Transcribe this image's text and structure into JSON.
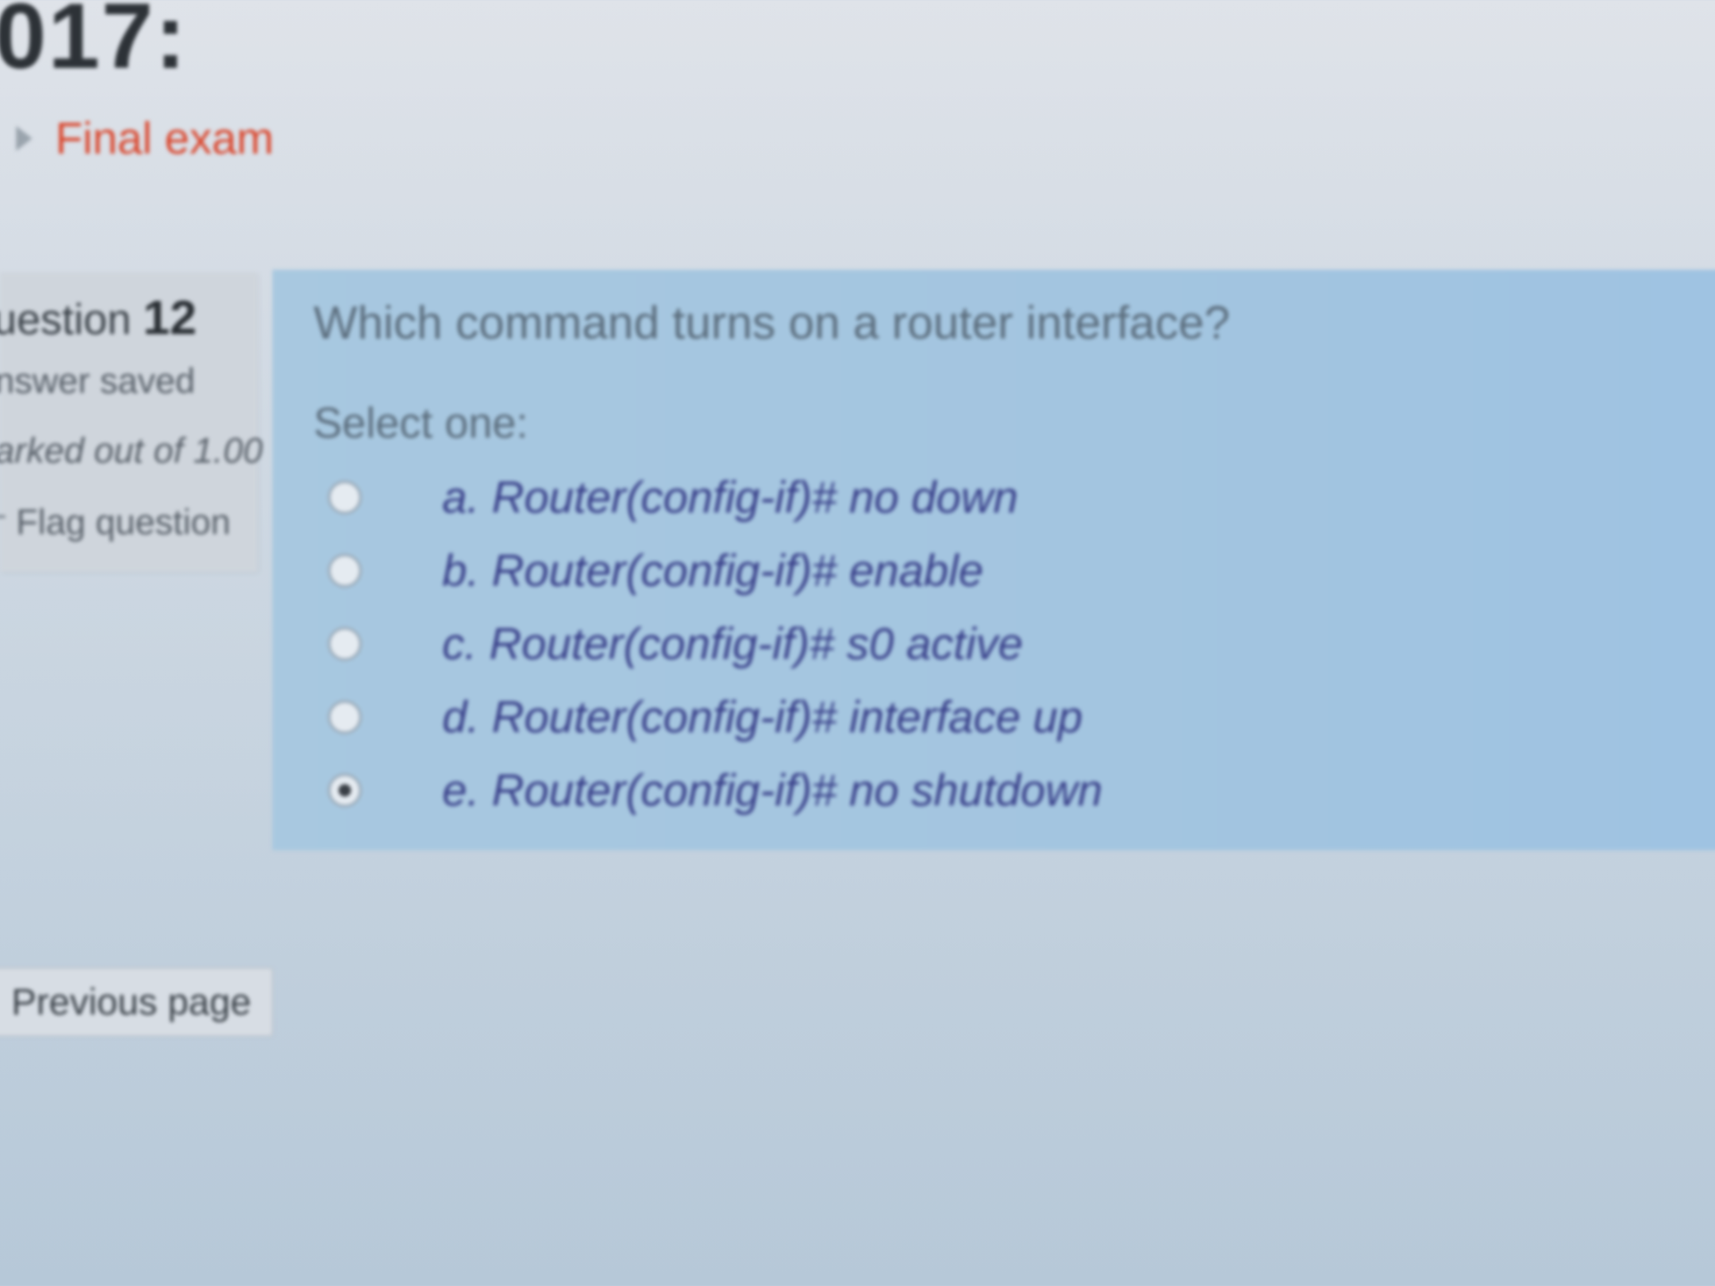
{
  "header": {
    "title": "017:"
  },
  "breadcrumb": {
    "link": "Final exam"
  },
  "question_info": {
    "number_label": "uestion",
    "number": "12",
    "status": "nswer saved",
    "marks": "arked out of 1.00",
    "flag_label": "Flag question"
  },
  "question": {
    "text": "Which command turns on a router interface?",
    "prompt": "Select one:",
    "options": [
      {
        "label": "a. Router(config-if)# no down",
        "selected": false
      },
      {
        "label": "b. Router(config-if)# enable",
        "selected": false
      },
      {
        "label": "c. Router(config-if)# s0 active",
        "selected": false
      },
      {
        "label": "d. Router(config-if)# interface up",
        "selected": false
      },
      {
        "label": "e. Router(config-if)# no shutdown",
        "selected": true
      }
    ]
  },
  "navigation": {
    "previous_label": "Previous page"
  },
  "colors": {
    "link": "#d9472e",
    "question_bg": "#a3c5e0",
    "option_text": "#39408a"
  }
}
